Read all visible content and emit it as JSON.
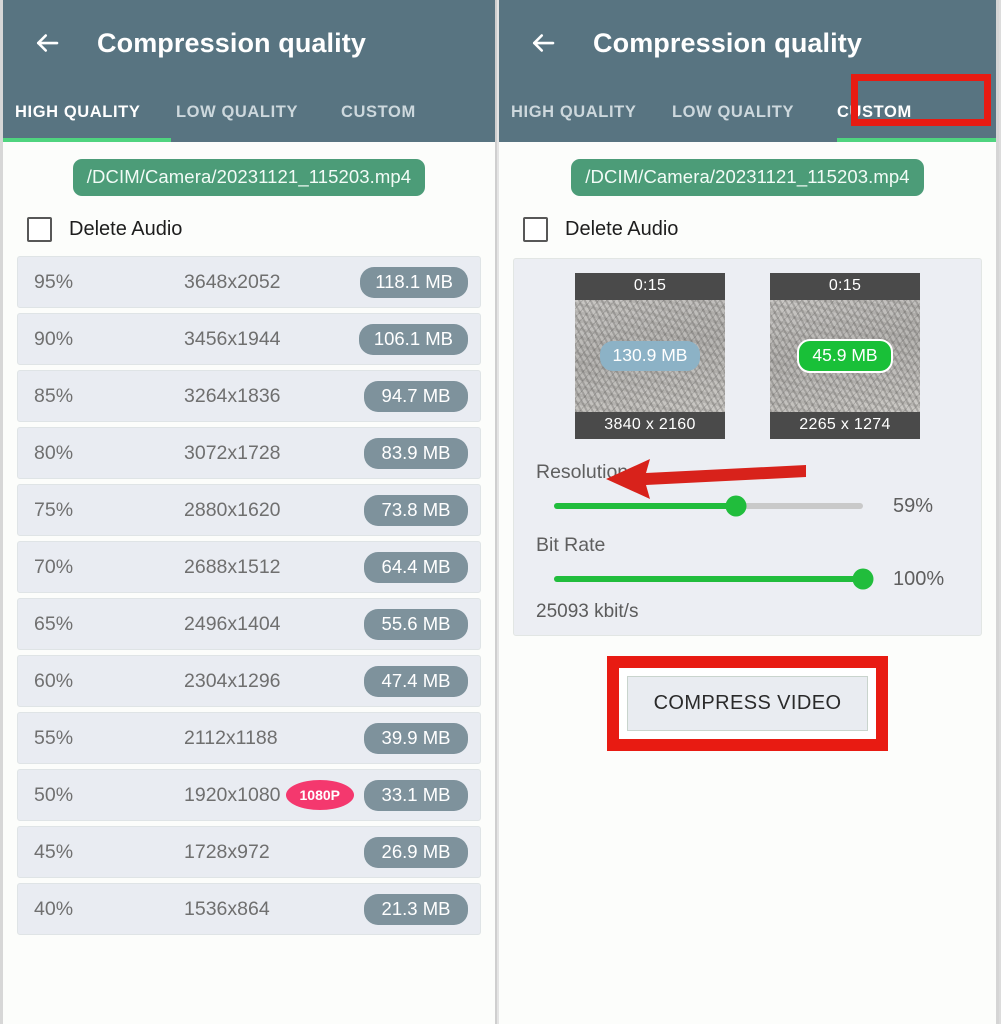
{
  "app": {
    "title": "Compression quality",
    "back_icon": "back-arrow-icon",
    "header_color": "#587481",
    "accent_green": "#4fd47f",
    "highlight_red": "#e81b12"
  },
  "tabs": [
    {
      "label": "HIGH QUALITY"
    },
    {
      "label": "LOW QUALITY"
    },
    {
      "label": "CUSTOM"
    }
  ],
  "left_screen": {
    "active_tab": "HIGH QUALITY",
    "file_path": "/DCIM/Camera/20231121_115203.mp4",
    "delete_audio_label": "Delete Audio",
    "delete_audio_checked": false,
    "columns": [
      "percent",
      "resolution",
      "badge",
      "size"
    ],
    "rows": [
      {
        "percent": "95%",
        "resolution": "3648x2052",
        "badge": "",
        "size": "118.1 MB"
      },
      {
        "percent": "90%",
        "resolution": "3456x1944",
        "badge": "",
        "size": "106.1 MB"
      },
      {
        "percent": "85%",
        "resolution": "3264x1836",
        "badge": "",
        "size": "94.7 MB"
      },
      {
        "percent": "80%",
        "resolution": "3072x1728",
        "badge": "",
        "size": "83.9 MB"
      },
      {
        "percent": "75%",
        "resolution": "2880x1620",
        "badge": "",
        "size": "73.8 MB"
      },
      {
        "percent": "70%",
        "resolution": "2688x1512",
        "badge": "",
        "size": "64.4 MB"
      },
      {
        "percent": "65%",
        "resolution": "2496x1404",
        "badge": "",
        "size": "55.6 MB"
      },
      {
        "percent": "60%",
        "resolution": "2304x1296",
        "badge": "",
        "size": "47.4 MB"
      },
      {
        "percent": "55%",
        "resolution": "2112x1188",
        "badge": "",
        "size": "39.9 MB"
      },
      {
        "percent": "50%",
        "resolution": "1920x1080",
        "badge": "1080P",
        "size": "33.1 MB"
      },
      {
        "percent": "45%",
        "resolution": "1728x972",
        "badge": "",
        "size": "26.9 MB"
      },
      {
        "percent": "40%",
        "resolution": "1536x864",
        "badge": "",
        "size": "21.3 MB"
      }
    ]
  },
  "right_screen": {
    "active_tab": "CUSTOM",
    "file_path": "/DCIM/Camera/20231121_115203.mp4",
    "delete_audio_label": "Delete Audio",
    "delete_audio_checked": false,
    "thumbnails": [
      {
        "duration": "0:15",
        "size": "130.9 MB",
        "resolution": "3840 x 2160",
        "size_color": "#8cb2c6"
      },
      {
        "duration": "0:15",
        "size": "45.9 MB",
        "resolution": "2265 x 1274",
        "size_color": "#19c038"
      }
    ],
    "resolution_slider": {
      "label": "Resolution",
      "value": "59%",
      "percent": 59
    },
    "bitrate_slider": {
      "label": "Bit Rate",
      "value": "100%",
      "percent": 100
    },
    "bitrate_text": "25093 kbit/s",
    "compress_button": "COMPRESS VIDEO"
  }
}
